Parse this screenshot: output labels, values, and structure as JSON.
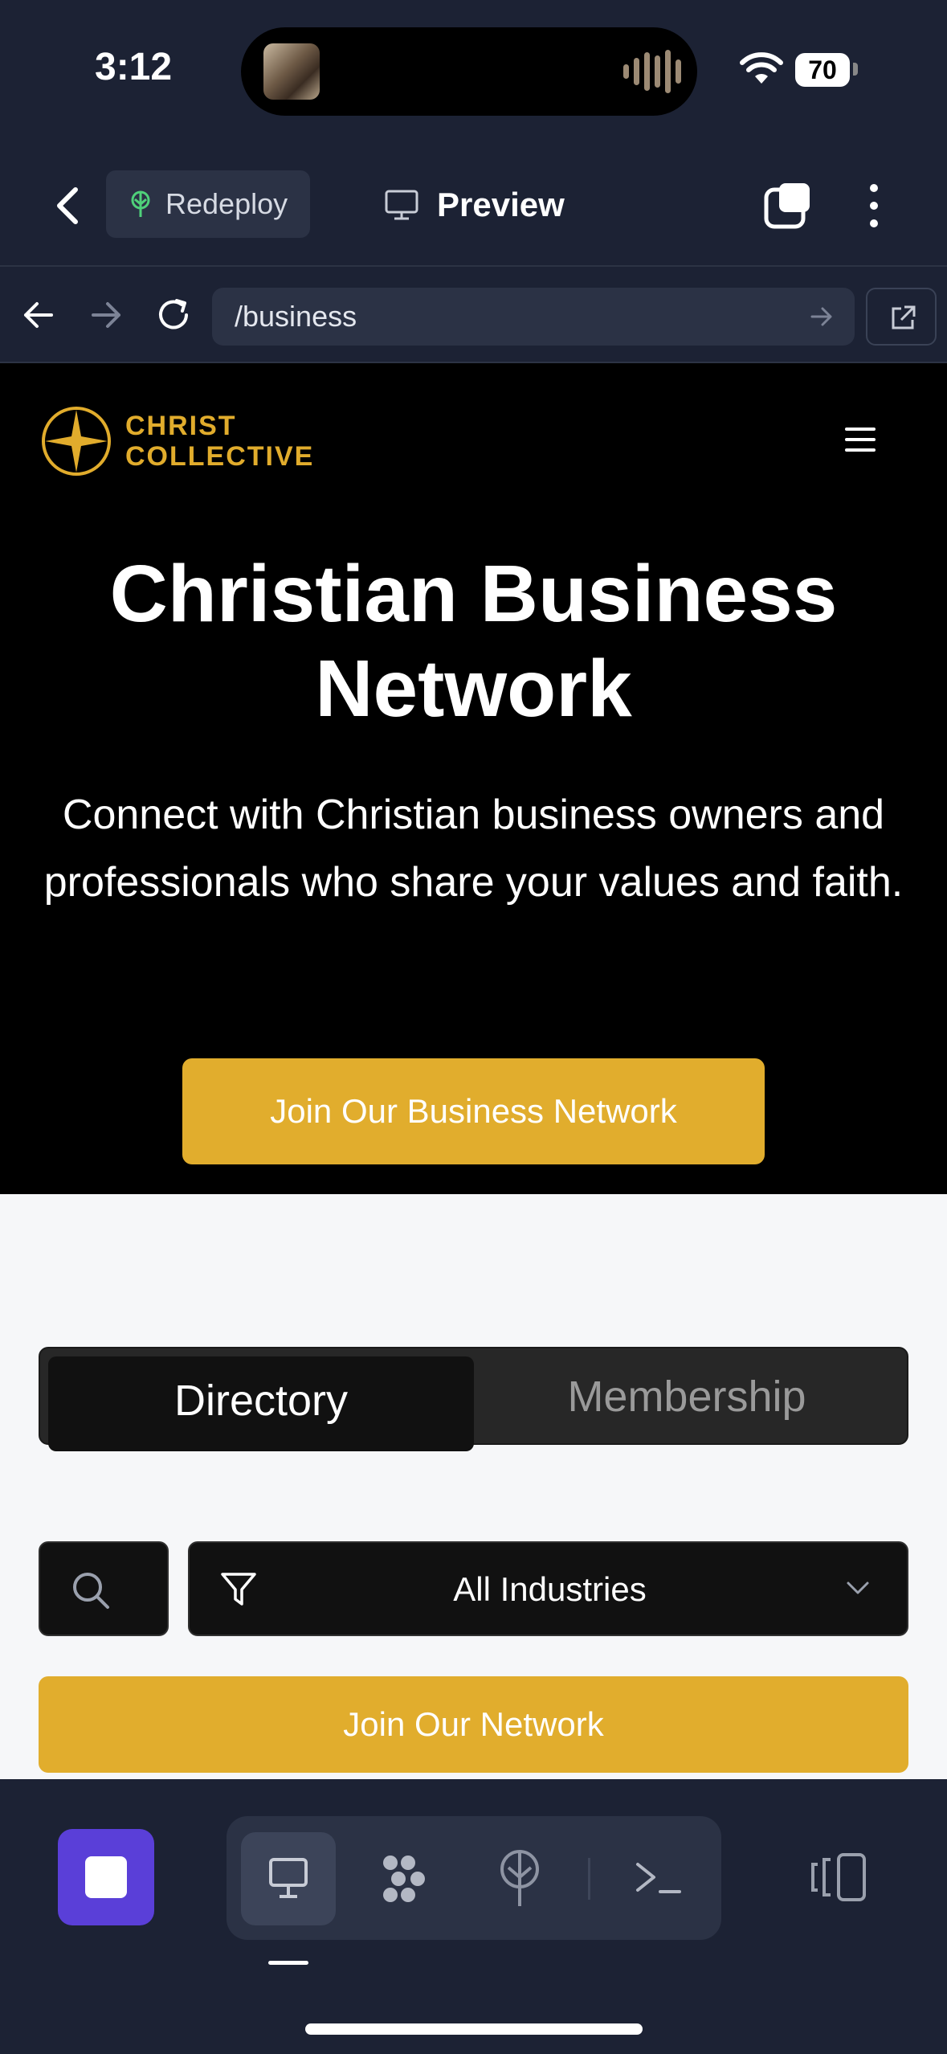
{
  "status_bar": {
    "time": "3:12",
    "battery": "70"
  },
  "toolbar": {
    "redeploy_label": "Redeploy",
    "preview_label": "Preview"
  },
  "urlbar": {
    "url": "/business"
  },
  "site": {
    "logo": {
      "line1": "CHRIST",
      "line2": "COLLECTIVE"
    },
    "hero": {
      "title": "Christian Business Network",
      "subtitle": "Connect with Christian business owners and professionals who share your values and faith.",
      "cta": "Join Our Business Network"
    },
    "tabs": {
      "directory": "Directory",
      "membership": "Membership"
    },
    "filter": {
      "industry": "All Industries"
    },
    "join_button": "Join Our Network"
  },
  "colors": {
    "accent": "#e1ad2d",
    "stop_button": "#5a3fd8",
    "chrome": "#1c2234"
  }
}
